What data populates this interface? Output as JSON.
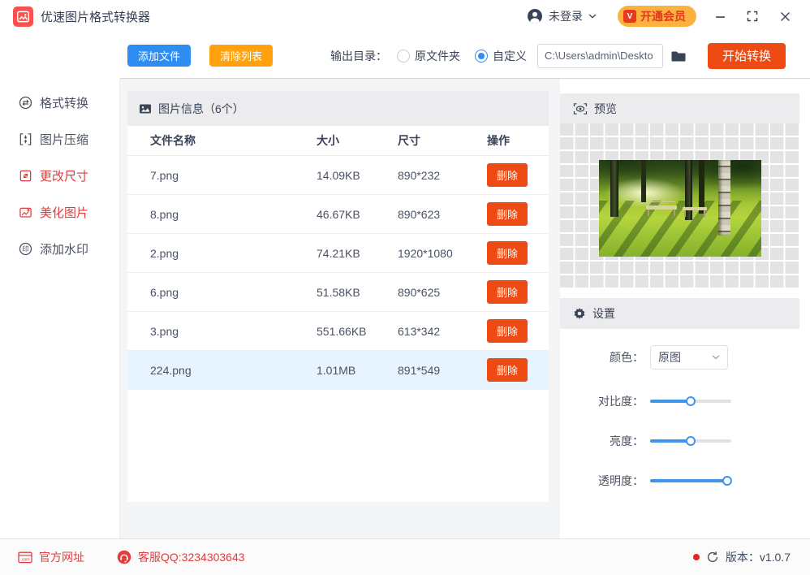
{
  "titlebar": {
    "title": "优速图片格式转换器",
    "login_label": "未登录",
    "vip_badge": "V",
    "vip_label": "开通会员"
  },
  "toolbar": {
    "add_files": "添加文件",
    "clear_list": "清除列表",
    "output_dir_label": "输出目录：",
    "radio_original": "原文件夹",
    "radio_custom": "自定义",
    "radio_selected": "自定义",
    "path_value": "C:\\Users\\admin\\Deskto",
    "start_convert": "开始转换"
  },
  "sidebar": {
    "items": [
      {
        "label": "格式转换",
        "active": false
      },
      {
        "label": "图片压缩",
        "active": false
      },
      {
        "label": "更改尺寸",
        "active": true
      },
      {
        "label": "美化图片",
        "active": true
      },
      {
        "label": "添加水印",
        "active": false
      }
    ]
  },
  "file_panel": {
    "title": "图片信息（6个）",
    "columns": [
      "文件名称",
      "大小",
      "尺寸",
      "操作"
    ],
    "delete_label": "删除",
    "rows": [
      {
        "name": "7.png",
        "size": "14.09KB",
        "dimensions": "890*232",
        "selected": false
      },
      {
        "name": "8.png",
        "size": "46.67KB",
        "dimensions": "890*623",
        "selected": false
      },
      {
        "name": "2.png",
        "size": "74.21KB",
        "dimensions": "1920*1080",
        "selected": false
      },
      {
        "name": "6.png",
        "size": "51.58KB",
        "dimensions": "890*625",
        "selected": false
      },
      {
        "name": "3.png",
        "size": "551.66KB",
        "dimensions": "613*342",
        "selected": false
      },
      {
        "name": "224.png",
        "size": "1.01MB",
        "dimensions": "891*549",
        "selected": true
      }
    ]
  },
  "preview_panel": {
    "title": "预览"
  },
  "settings_panel": {
    "title": "设置",
    "color_label": "颜色：",
    "color_value": "原图",
    "sliders": [
      {
        "label": "对比度：",
        "value": 50
      },
      {
        "label": "亮度：",
        "value": 50
      },
      {
        "label": "透明度：",
        "value": 95
      }
    ]
  },
  "statusbar": {
    "website": "官方网址",
    "qq": "客服QQ:3234303643",
    "version": "版本：v1.0.7"
  },
  "colors": {
    "brand_red": "#fb5050",
    "accent_blue": "#2f8df2",
    "accent_orange": "#ffa20d",
    "action_red": "#ee4a14",
    "vip_bg": "#fcb23f",
    "vip_text": "#e0381c",
    "sidebar_active": "#e23a3a",
    "selected_row_bg": "#e8f4fd",
    "slider_blue": "#3f95ea",
    "status_red": "#e23d3d"
  }
}
